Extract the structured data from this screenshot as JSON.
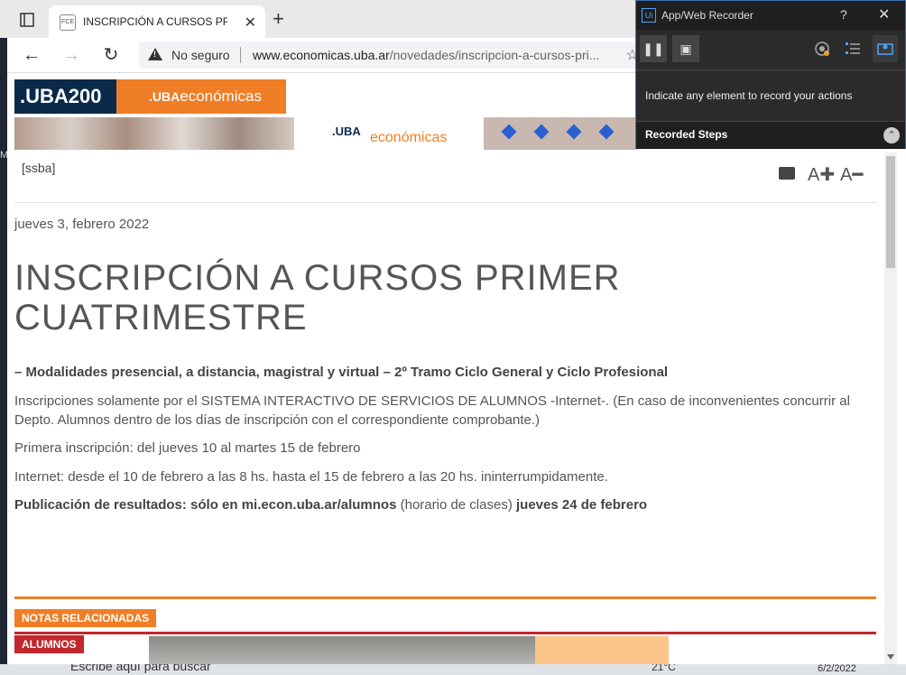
{
  "browser": {
    "tab_title": "INSCRIPCIÓN A CURSOS PRIMER",
    "tab_close": "✕",
    "new_tab": "+",
    "not_secure": "No seguro",
    "url_host": "www.economicas.uba.ar",
    "url_path": "/novedades/inscripcion-a-cursos-pri...",
    "back": "←",
    "forward": "→",
    "reload": "↻",
    "fav_star": "☆"
  },
  "side_strip_text": "M",
  "site": {
    "logo_uba200": ".UBA200",
    "logo_economicas_prefix": ".UBA",
    "logo_economicas": "económicas",
    "banner_prefix": ".UBA",
    "banner_text": "económicas"
  },
  "article": {
    "tag": "[ssba]",
    "font_increase": "A✚",
    "font_decrease": "A━",
    "date": "jueves 3, febrero 2022",
    "title": "INSCRIPCIÓN A CURSOS PRIMER CUATRIMESTRE",
    "subtitle": "– Modalidades presencial, a distancia, magistral y virtual – 2º Tramo Ciclo General y Ciclo Profesional",
    "p1": "Inscripciones solamente por el SISTEMA INTERACTIVO DE SERVICIOS DE ALUMNOS -Internet-. (En caso de inconvenientes concurrir al Depto. Alumnos dentro de los días de inscripción con el correspondiente comprobante.)",
    "p2": "Primera inscripción: del jueves 10 al martes 15 de febrero",
    "p3": "Internet: desde el 10 de febrero a las 8 hs. hasta el 15 de febrero a las 20 hs. ininterrumpidamente.",
    "p4_bold1": "Publicación de resultados: sólo en mi.econ.uba.ar/alumnos",
    "p4_mid": " (horario de clases) ",
    "p4_bold2": "jueves 24 de febrero",
    "related_label": "NOTAS RELACIONADAS",
    "category_label": "ALUMNOS"
  },
  "taskbar": {
    "search": "Escribe aquí para buscar",
    "temp": "21°C",
    "date": "6/2/2022"
  },
  "recorder": {
    "title": "App/Web Recorder",
    "logo": "Ui",
    "help": "?",
    "close": "✕",
    "instruction": "Indicate any element to record your actions",
    "steps_label": "Recorded Steps",
    "collapse": "⌃",
    "pause_icon": "❚❚",
    "save_icon": "▣"
  },
  "colors": {
    "orange": "#f07e26",
    "navy": "#0b2a4a",
    "red": "#c0282d"
  }
}
